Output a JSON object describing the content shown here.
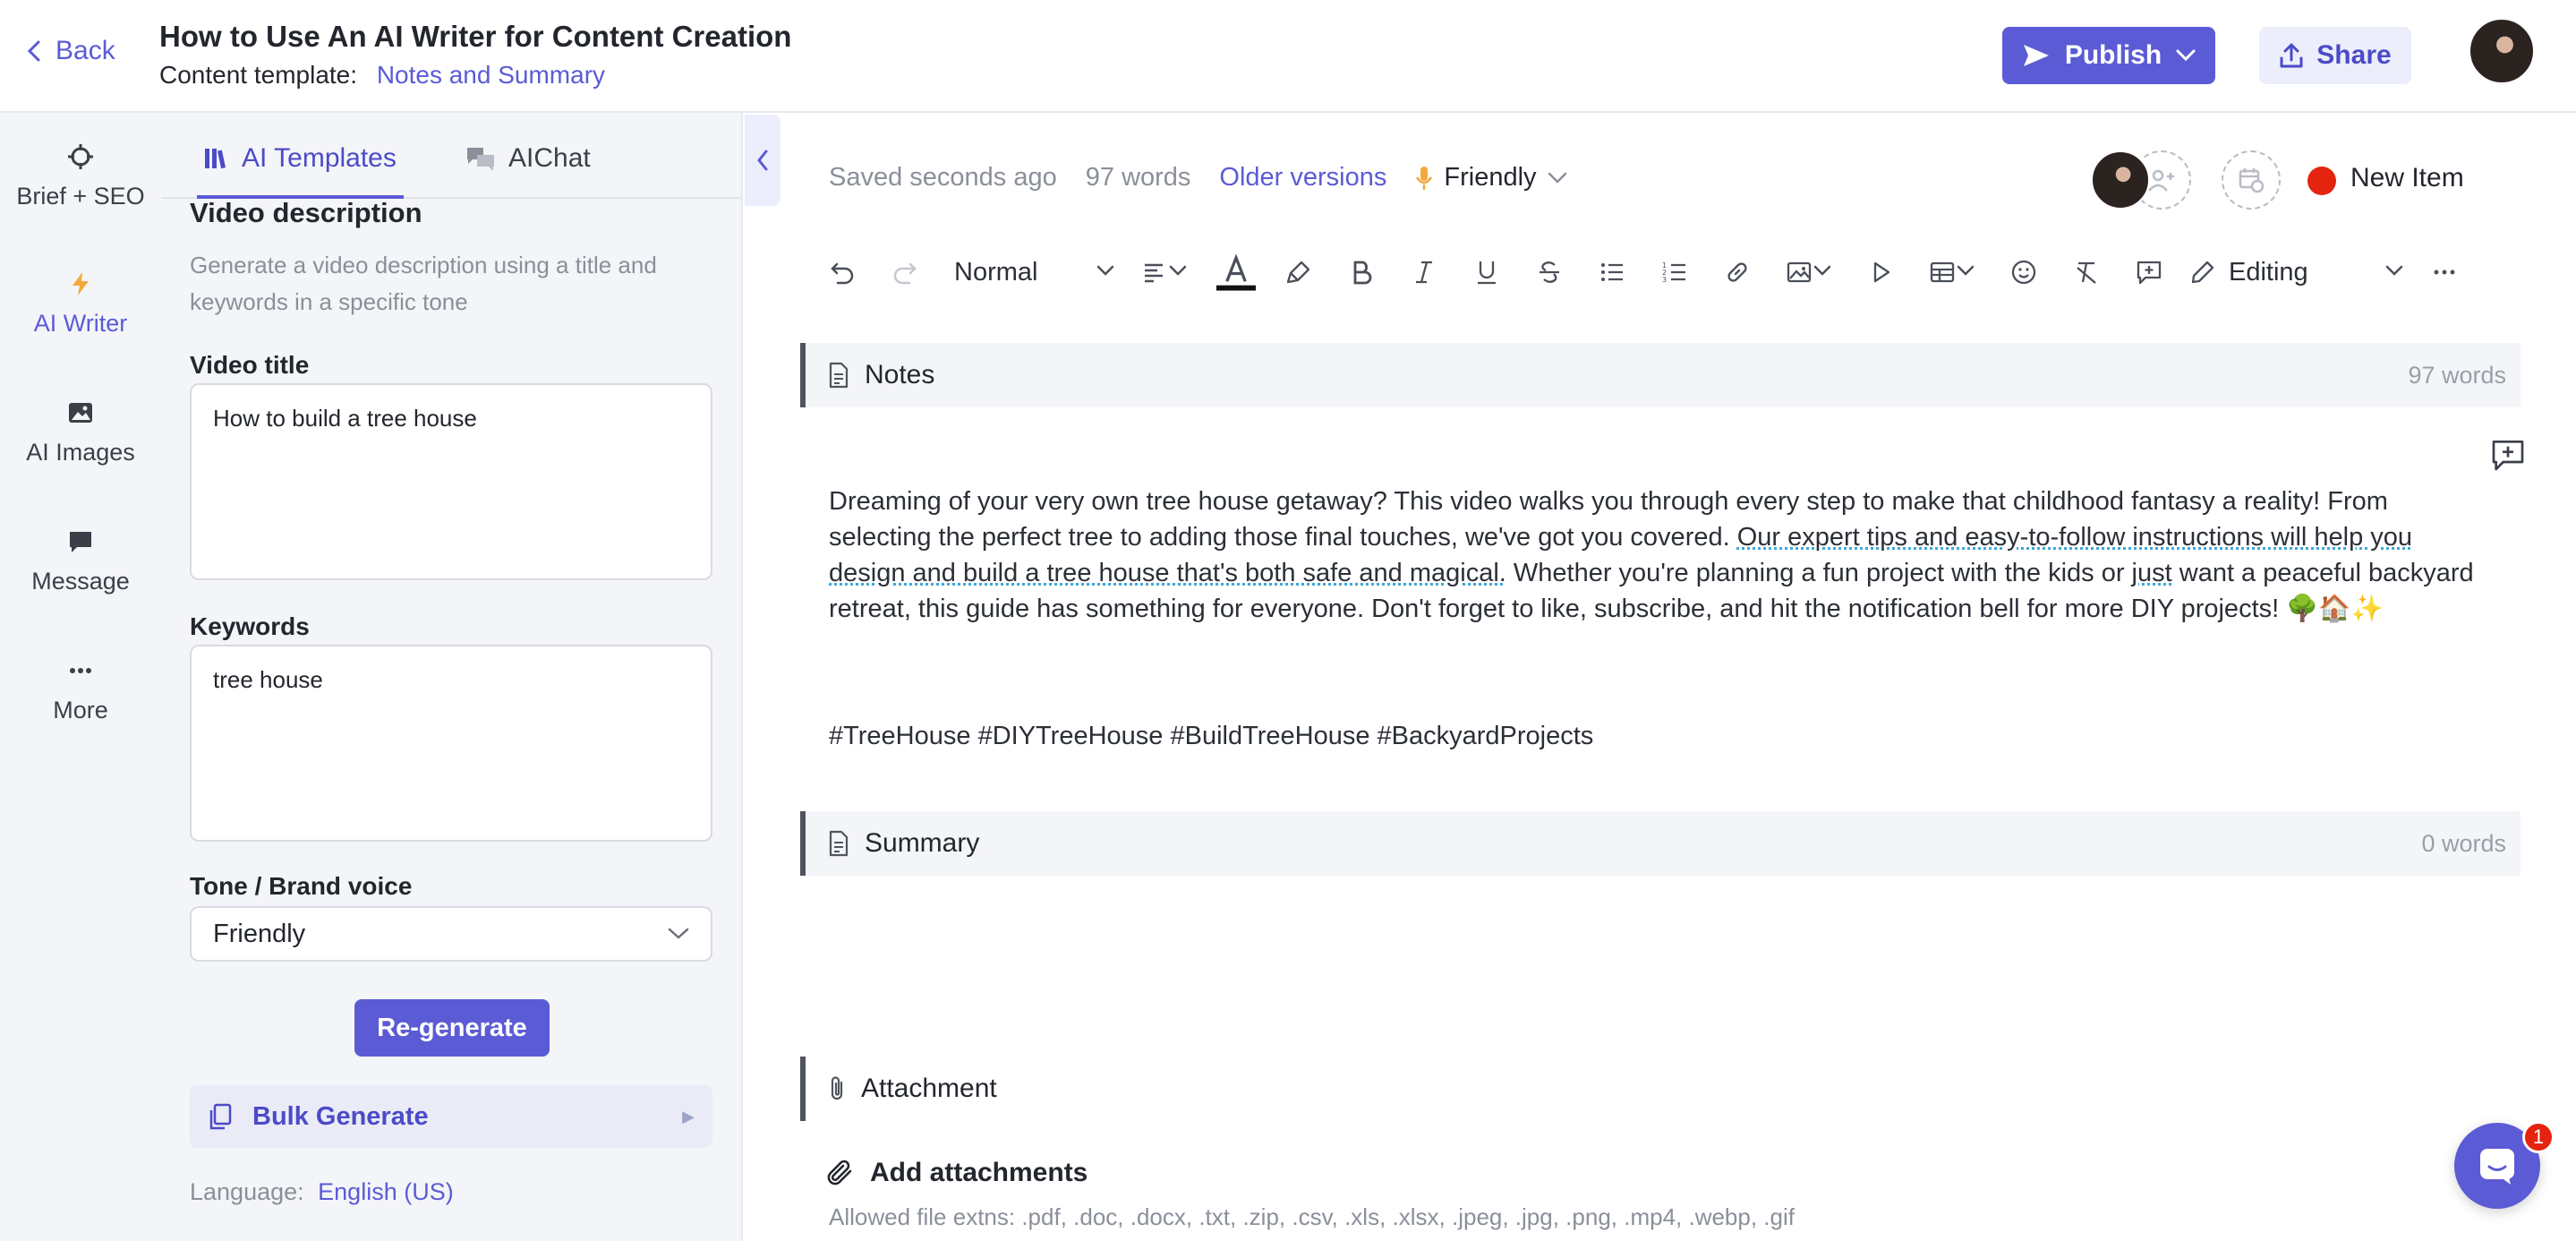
{
  "header": {
    "back_label": "Back",
    "title": "How to Use An AI Writer for Content Creation",
    "template_prefix": "Content template:",
    "template_name": "Notes and Summary",
    "publish_label": "Publish",
    "share_label": "Share"
  },
  "rail": {
    "items": [
      {
        "label": "Brief + SEO",
        "icon": "crosshair-icon"
      },
      {
        "label": "AI Writer",
        "icon": "bolt-icon"
      },
      {
        "label": "AI Images",
        "icon": "image-icon"
      },
      {
        "label": "Message",
        "icon": "message-icon"
      },
      {
        "label": "More",
        "icon": "more-dots-icon"
      }
    ],
    "active": "AI Writer"
  },
  "panel": {
    "tabs": [
      {
        "label": "AI Templates",
        "icon": "library-icon"
      },
      {
        "label": "AIChat",
        "icon": "chat-bubbles-icon"
      }
    ],
    "section_title": "Video description",
    "section_desc": "Generate a video description using a title and keywords in a specific tone",
    "video_title_label": "Video title",
    "video_title_value": "How to build a tree house",
    "keywords_label": "Keywords",
    "keywords_value": "tree house",
    "tone_label": "Tone / Brand voice",
    "tone_value": "Friendly",
    "regenerate_label": "Re-generate",
    "bulk_label": "Bulk Generate",
    "language_prefix": "Language:",
    "language_value": "English (US)"
  },
  "editor": {
    "saved": "Saved seconds ago",
    "word_count": "97 words",
    "older_versions": "Older versions",
    "tone": "Friendly",
    "status_label": "New Item",
    "status_color": "#e5240f",
    "toolbar": {
      "style": "Normal",
      "mode": "Editing"
    },
    "sections": {
      "notes": {
        "title": "Notes",
        "count": "97 words",
        "body_part1": "Dreaming of your very own tree house getaway? This video walks you through every step to make that childhood fantasy a reality! From selecting the perfect tree to adding those final touches, we've got you covered. ",
        "body_underlined": "Our expert tips and easy-to-follow instructions will help you design and build a tree house that's both safe and magical.",
        "body_part2": " Whether you're planning a fun project with the kids or ",
        "body_underlined2": "just",
        "body_part3": " want a peaceful backyard retreat, this guide has something for everyone. Don't forget to like, subscribe, and hit the notification bell for more DIY projects! 🌳🏠✨",
        "hashtags": "#TreeHouse #DIYTreeHouse #BuildTreeHouse #BackyardProjects"
      },
      "summary": {
        "title": "Summary",
        "count": "0 words"
      },
      "attachment": {
        "title": "Attachment",
        "add_label": "Add attachments",
        "allowed": "Allowed file extns: .pdf, .doc, .docx, .txt, .zip, .csv, .xls, .xlsx, .jpeg, .jpg, .png, .mp4, .webp, .gif"
      }
    }
  },
  "chat": {
    "badge": "1"
  },
  "colors": {
    "accent": "#5b5bd6"
  }
}
